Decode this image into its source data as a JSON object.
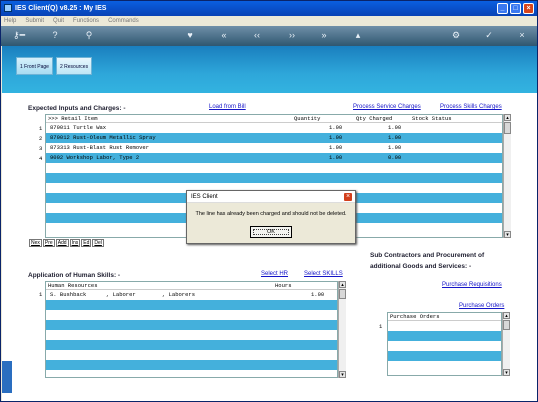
{
  "window": {
    "title": "IES Client(Q) v8.25 : My IES"
  },
  "menu": [
    "Help",
    "Submit",
    "Quit",
    "Functions",
    "Commands"
  ],
  "toolbar_icons": [
    "key-icon",
    "help-icon",
    "search-icon",
    "heart-icon",
    "first-icon",
    "prev-icon",
    "next-icon",
    "last-icon",
    "up-icon",
    "gear-icon",
    "check-icon",
    "close-icon"
  ],
  "tabs": [
    {
      "label": "1 Front Page"
    },
    {
      "label": "2 Resources"
    }
  ],
  "inputs": {
    "title": "Expected Inputs and Charges: -",
    "load_link": "Load from Bill",
    "process_service": "Process Service Charges",
    "process_skills": "Process Skills Charges",
    "columns": {
      "item": ">>> Retail Item",
      "qty": "Quantity",
      "charged": "Qty Charged",
      "stock": "Stock Status"
    },
    "rows": [
      {
        "n": "1",
        "item": "870011 Turtle Wax",
        "qty": "1.00",
        "charged": "1.00"
      },
      {
        "n": "2",
        "item": "870012 Rust-Oleum Metallic Spray",
        "qty": "1.00",
        "charged": "1.00"
      },
      {
        "n": "3",
        "item": "873313 Rust-Blast Rust Remover",
        "qty": "1.00",
        "charged": "1.00"
      },
      {
        "n": "4",
        "item": "9002 Workshop Labor, Type 2",
        "qty": "1.00",
        "charged": "0.00"
      }
    ],
    "nav": [
      "Nex",
      "Pre",
      "Add",
      "Ins",
      "Ed",
      "Del"
    ]
  },
  "subcontractors": {
    "title1": "Sub Contractors and Procurement of",
    "title2": "additional Goods and Services: -",
    "requisitions": "Purchase Requisitions",
    "orders_link": "Purchase Orders",
    "column": "Purchase Orders",
    "row_number": "1"
  },
  "skills": {
    "title": "Application of Human Skills: -",
    "select_hr": "Select HR",
    "select_skills": "Select SKILLS",
    "columns": {
      "hr": "Human Resources",
      "hours": "Hours"
    },
    "rows": [
      {
        "n": "1",
        "hr": "S. Bushback",
        "type": ", Laborer",
        "group": ", Laborers",
        "hours": "1.00"
      }
    ]
  },
  "dialog": {
    "title": "IES Client",
    "message": "The line has already been charged and should not be deleted.",
    "ok": "OK"
  },
  "colors": {
    "band": "#44b0dc",
    "header": "#2ea7da",
    "link": "#1414c8"
  }
}
